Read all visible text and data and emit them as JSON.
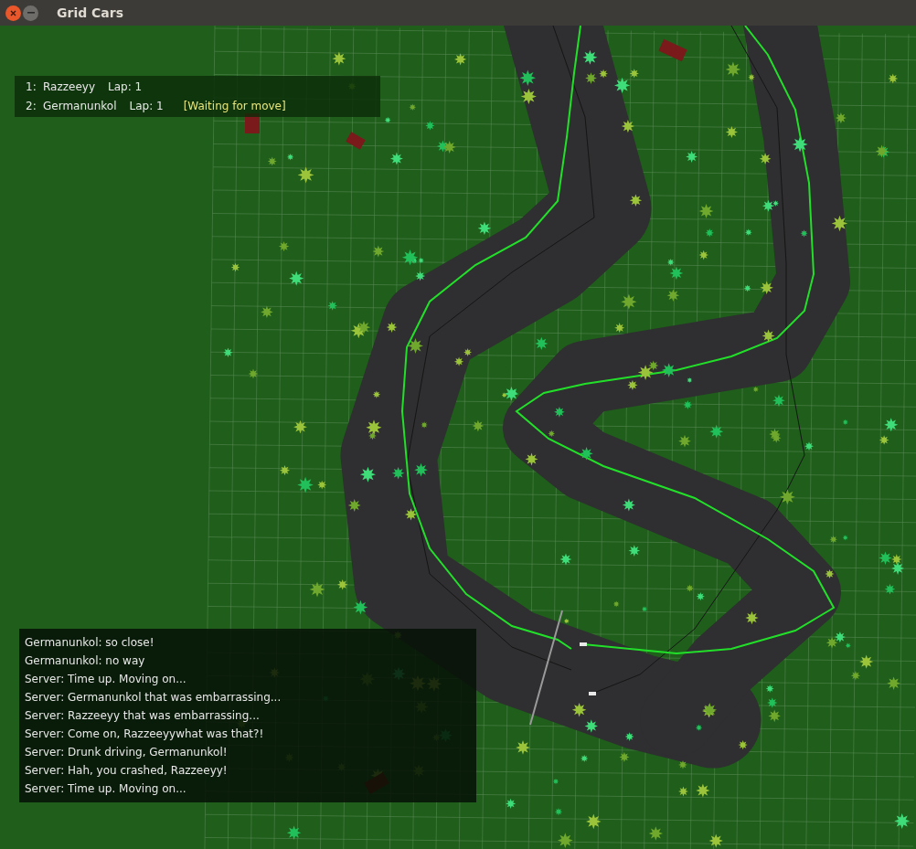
{
  "window": {
    "title": "Grid Cars"
  },
  "scoreboard": [
    {
      "rank": "1:",
      "name": "Razzeeyy",
      "lap": "Lap: 1"
    },
    {
      "rank": "2:",
      "name": "Germanunkol",
      "lap": "Lap: 1",
      "status": "[Waiting for move]"
    }
  ],
  "chat": [
    "Germanunkol: so close!",
    "Germanunkol: no way",
    "Server: Time up. Moving on...",
    "Server: Germanunkol that was embarrassing...",
    "Server: Razzeeyy that was embarrassing...",
    "Server: Come on, Razzeeyywhat was that?!",
    "Server: Drunk driving, Germanunkol!",
    "Server: Hah, you crashed, Razzeeyy!",
    "Server: Time up. Moving on..."
  ]
}
